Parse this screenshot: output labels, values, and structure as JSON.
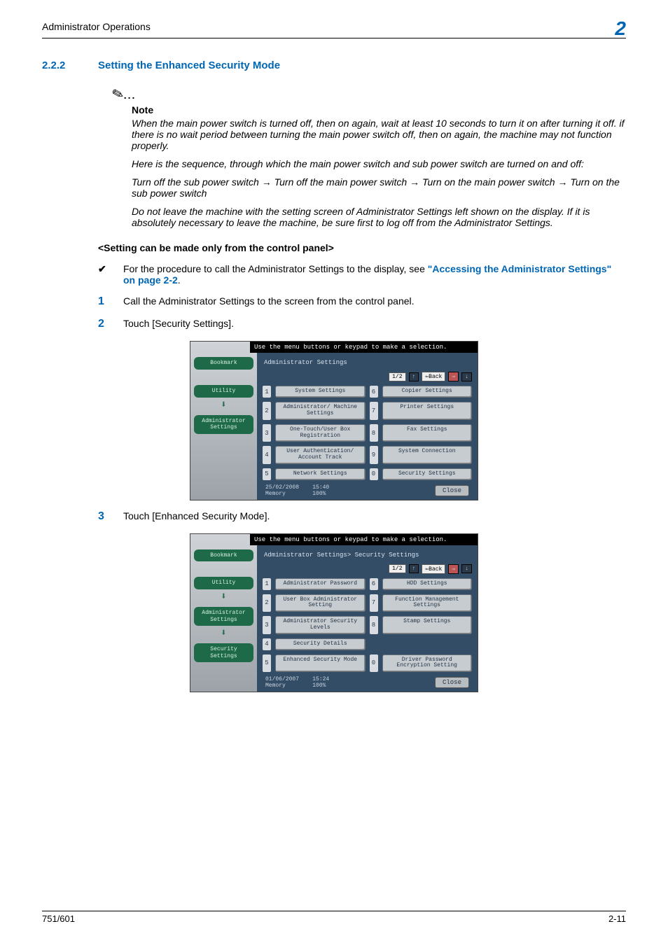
{
  "header": {
    "title": "Administrator Operations",
    "chapter": "2"
  },
  "section": {
    "number": "2.2.2",
    "title": "Setting the Enhanced Security Mode"
  },
  "note": {
    "label": "Note",
    "p1": "When the main power switch is turned off, then on again, wait at least 10 seconds to turn it on after turning it off. if there is no wait period between turning the main power switch off, then on again, the machine may not function properly.",
    "p2": "Here is the sequence, through which the main power switch and sub power switch are turned on and off:",
    "p3": "Turn off the sub power switch → Turn off the main power switch → Turn on the main power switch → Turn on the sub power switch",
    "p4": "Do not leave the machine with the setting screen of Administrator Settings left shown on the display. If it is absolutely necessary to leave the machine, be sure first to log off from the Administrator Settings."
  },
  "subhead": "<Setting can be made only from the control panel>",
  "bullet": {
    "lead": "For the procedure to call the Administrator Settings to the display, see ",
    "link": "\"Accessing the Administrator Settings\" on page 2-2",
    "tail": "."
  },
  "steps": {
    "s1": "Call the Administrator Settings to the screen from the control panel.",
    "s2": "Touch [Security Settings].",
    "s3": "Touch [Enhanced Security Mode]."
  },
  "panel_common": {
    "hint": "Use the menu buttons or keypad to make a selection.",
    "page": "1/2",
    "back": "⇐Back",
    "fwd": "⇒",
    "close": "Close",
    "sidebar": {
      "bookmark": "Bookmark",
      "utility": "Utility",
      "admin": "Administrator Settings",
      "security": "Security Settings"
    }
  },
  "panel1": {
    "crumb": "Administrator Settings",
    "menu": {
      "1": "System Settings",
      "2": "Administrator/\nMachine Settings",
      "3": "One-Touch/User Box\nRegistration",
      "4": "User Authentication/\nAccount Track",
      "5": "Network Settings",
      "6": "Copier Settings",
      "7": "Printer Settings",
      "8": "Fax Settings",
      "9": "System Connection",
      "0": "Security Settings"
    },
    "footer": {
      "date": "25/02/2008",
      "time": "15:40",
      "mem": "Memory",
      "pct": "100%"
    }
  },
  "panel2": {
    "crumb": "Administrator Settings> Security Settings",
    "menu": {
      "1": "Administrator Password",
      "2": "User Box Administrator\nSetting",
      "3": "Administrator Security\nLevels",
      "4": "Security Details",
      "5": "Enhanced Security Mode",
      "6": "HDD Settings",
      "7": "Function Management Settings",
      "8": "Stamp Settings",
      "0": "Driver Password\nEncryption Setting"
    },
    "footer": {
      "date": "01/06/2007",
      "time": "15:24",
      "mem": "Memory",
      "pct": "100%"
    }
  },
  "footer": {
    "left": "751/601",
    "right": "2-11"
  }
}
